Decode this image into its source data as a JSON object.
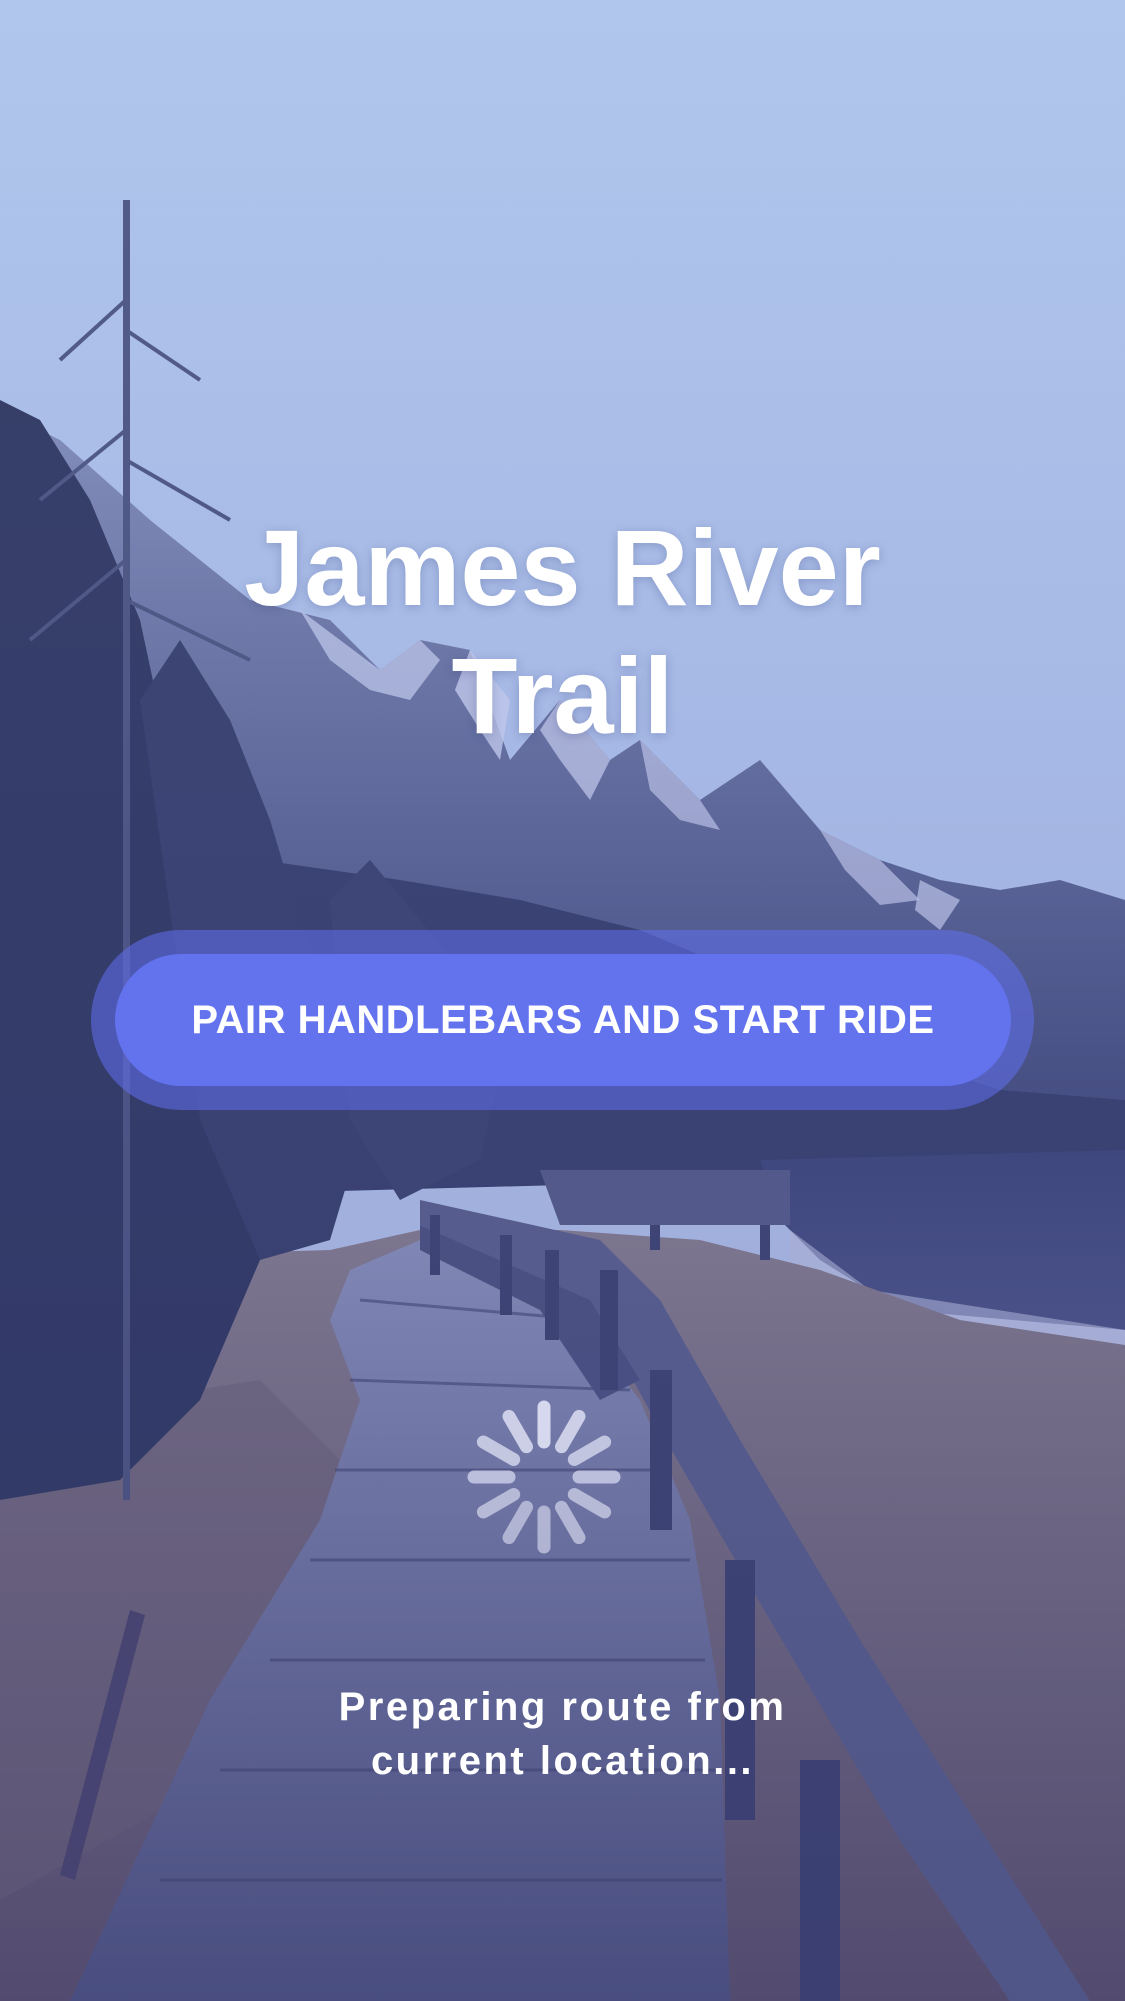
{
  "screen": {
    "title_line_1": "James River",
    "title_line_2": "Trail",
    "primary_action_label": "PAIR HANDLEBARS AND START RIDE",
    "status_line_1": "Preparing route from",
    "status_line_2": "current location..."
  },
  "icons": {
    "loading": "loading-spinner-icon"
  },
  "colors": {
    "accent": "#6373ee",
    "text": "#ffffff"
  }
}
